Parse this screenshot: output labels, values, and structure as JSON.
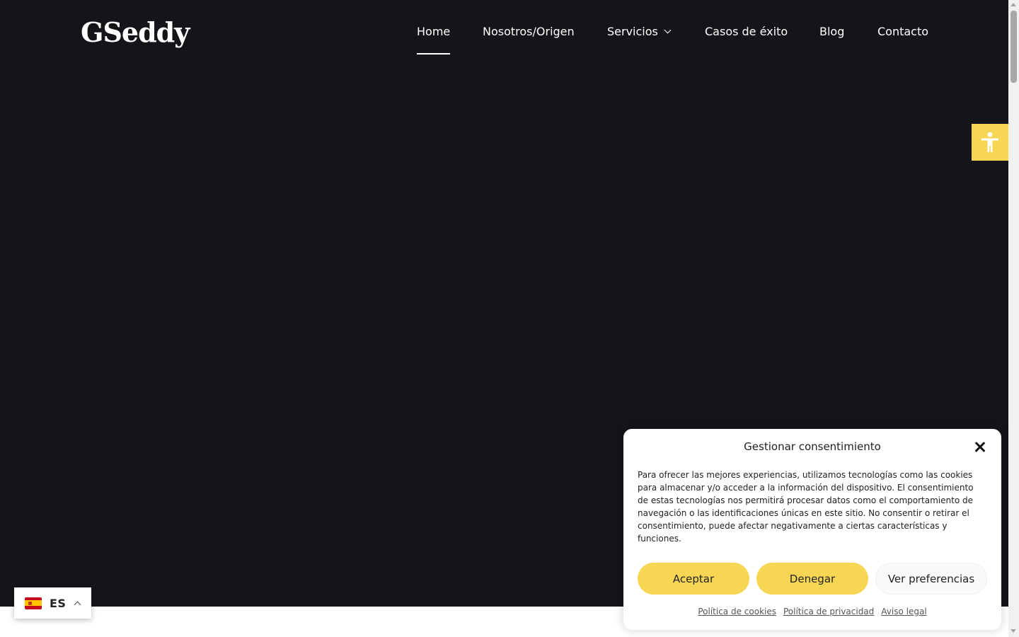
{
  "header": {
    "logo_text": "GSeddy",
    "nav": [
      {
        "label": "Home",
        "active": true
      },
      {
        "label": "Nosotros/Origen"
      },
      {
        "label": "Servicios",
        "has_dropdown": true
      },
      {
        "label": "Casos de éxito"
      },
      {
        "label": "Blog"
      },
      {
        "label": "Contacto"
      }
    ]
  },
  "accessibility": {
    "icon": "accessibility-icon",
    "color": "#f7d654"
  },
  "language": {
    "code": "ES",
    "flag": "spain-flag-icon"
  },
  "cookie_banner": {
    "title": "Gestionar consentimiento",
    "text": "Para ofrecer las mejores experiencias, utilizamos tecnologías como las cookies para almacenar y/o acceder a la información del dispositivo. El consentimiento de estas tecnologías nos permitirá procesar datos como el comportamiento de navegación o las identificaciones únicas en este sitio. No consentir o retirar el consentimiento, puede afectar negativamente a ciertas características y funciones.",
    "buttons": {
      "accept": "Aceptar",
      "deny": "Denegar",
      "preferences": "Ver preferencias"
    },
    "links": [
      "Política de cookies",
      "Política de privacidad",
      "Aviso legal"
    ]
  },
  "colors": {
    "hero_bg": "#131518",
    "accent": "#f7d654"
  }
}
